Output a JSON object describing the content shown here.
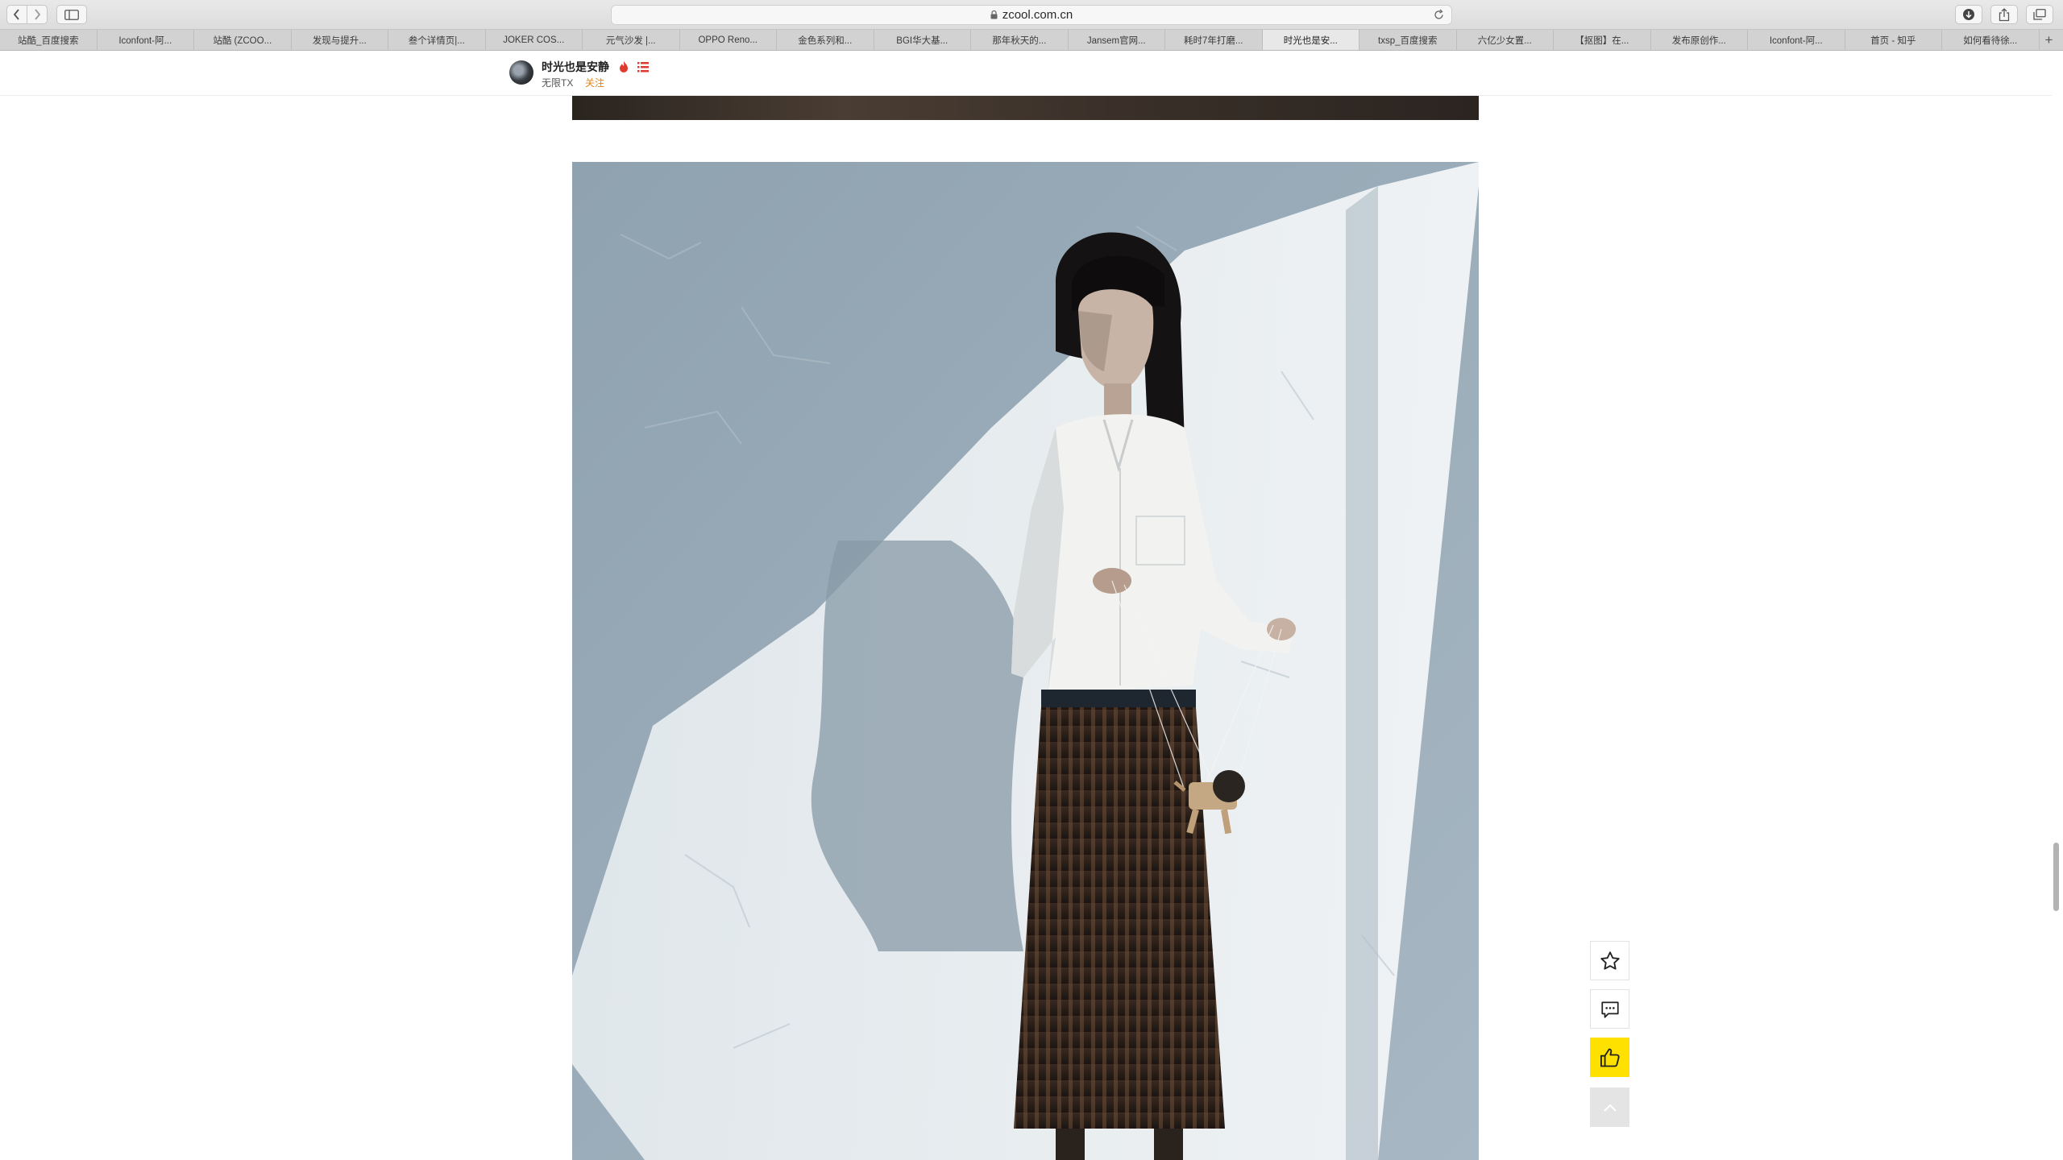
{
  "browser": {
    "url": "zcool.com.cn",
    "tabs": [
      {
        "label": "站酷_百度搜索"
      },
      {
        "label": "Iconfont-阿..."
      },
      {
        "label": "站酷 (ZCOO..."
      },
      {
        "label": "发现与提升..."
      },
      {
        "label": "叁个详情页|..."
      },
      {
        "label": "JOKER COS..."
      },
      {
        "label": "元气沙发 |..."
      },
      {
        "label": "OPPO Reno..."
      },
      {
        "label": "金色系列和..."
      },
      {
        "label": "BGI华大基..."
      },
      {
        "label": "那年秋天的..."
      },
      {
        "label": "Jansem官网..."
      },
      {
        "label": "耗时7年打磨..."
      },
      {
        "label": "时光也是安...",
        "active": true
      },
      {
        "label": "txsp_百度搜索"
      },
      {
        "label": "六亿少女置..."
      },
      {
        "label": "【抠图】在..."
      },
      {
        "label": "发布原创作..."
      },
      {
        "label": "Iconfont-阿..."
      },
      {
        "label": "首页 - 知乎"
      },
      {
        "label": "如何看待徐..."
      }
    ],
    "new_tab_symbol": "+"
  },
  "author": {
    "name": "时光也是安静",
    "team": "无限TX",
    "follow_label": "关注"
  },
  "icons": {
    "star": "star-icon",
    "comment": "comment-icon",
    "like": "thumbs-up-icon",
    "back_to_top": "chevron-up-icon"
  },
  "colors": {
    "like_accent": "#ffe100",
    "follow_accent": "#e0851c",
    "badge_red": "#e03a2e"
  }
}
